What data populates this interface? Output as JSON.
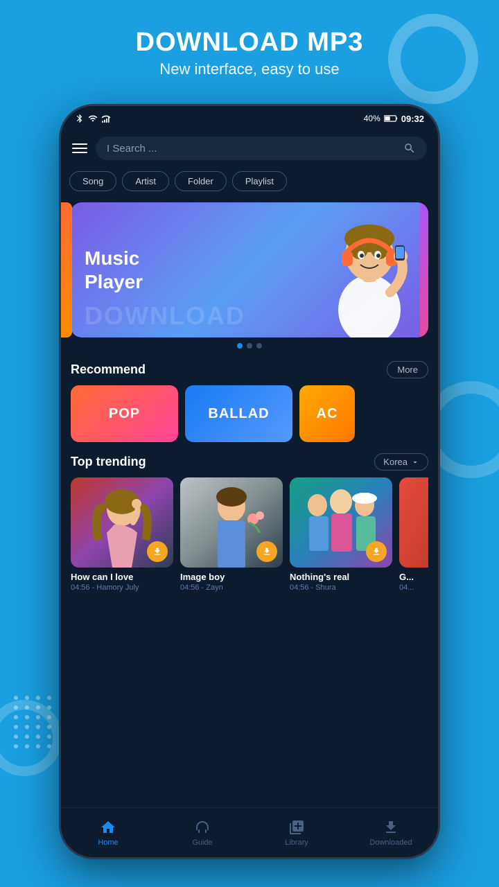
{
  "app": {
    "title": "DOWNLOAD MP3",
    "subtitle": "New interface, easy to use"
  },
  "statusBar": {
    "time": "09:32",
    "battery": "40%"
  },
  "search": {
    "placeholder": "I Search ..."
  },
  "tabs": [
    {
      "label": "Song",
      "active": false
    },
    {
      "label": "Artist",
      "active": false
    },
    {
      "label": "Folder",
      "active": false
    },
    {
      "label": "Playlist",
      "active": false
    }
  ],
  "banner": {
    "text_line1": "Music",
    "text_line2": "Player",
    "watermark": "DOWNLOAD"
  },
  "recommend": {
    "title": "Recommend",
    "more_label": "More",
    "genres": [
      {
        "label": "POP",
        "style": "pop"
      },
      {
        "label": "BALLAD",
        "style": "ballad"
      },
      {
        "label": "AC",
        "style": "ac"
      }
    ]
  },
  "trending": {
    "title": "Top trending",
    "country_label": "Korea",
    "songs": [
      {
        "title": "How can I love",
        "meta": "04:56 - Hamory July",
        "thumb_style": "girl"
      },
      {
        "title": "Image boy",
        "meta": "04:56 - Zayn",
        "thumb_style": "boy"
      },
      {
        "title": "Nothing's real",
        "meta": "04:56 - Shura",
        "thumb_style": "group"
      },
      {
        "title": "G...",
        "meta": "04...",
        "thumb_style": "partial"
      }
    ]
  },
  "bottomNav": [
    {
      "label": "Home",
      "icon": "home",
      "active": true
    },
    {
      "label": "Guide",
      "icon": "headphones",
      "active": false
    },
    {
      "label": "Library",
      "icon": "library",
      "active": false
    },
    {
      "label": "Downloaded",
      "icon": "download",
      "active": false
    }
  ]
}
